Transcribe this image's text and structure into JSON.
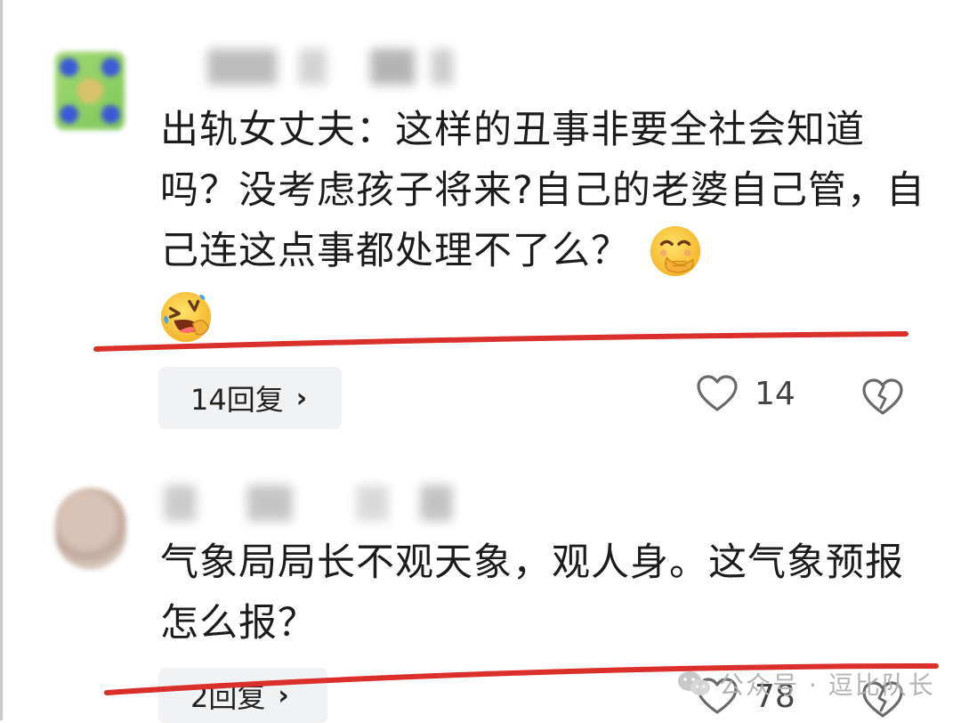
{
  "comments": [
    {
      "text": "出轨女丈夫：这样的丑事非要全社会知道吗？没考虑孩子将来?自己的老婆自己管，自己连这点事都处理不了么？",
      "emoji_inline": "face-with-hand-over-mouth-icon",
      "emoji_next_line": "rolling-laughing-icon",
      "reply_label": "14回复",
      "like_count": "14"
    },
    {
      "text": "气象局局长不观天象，观人身。这气象预报怎么报？",
      "reply_label": "2回复",
      "like_count": "78"
    }
  ],
  "watermark": {
    "text": "公众号 · 逗比队长"
  },
  "colors": {
    "underline_red": "#d9302c",
    "pill_bg": "#f1f2f4",
    "text": "#1c1c1c"
  }
}
